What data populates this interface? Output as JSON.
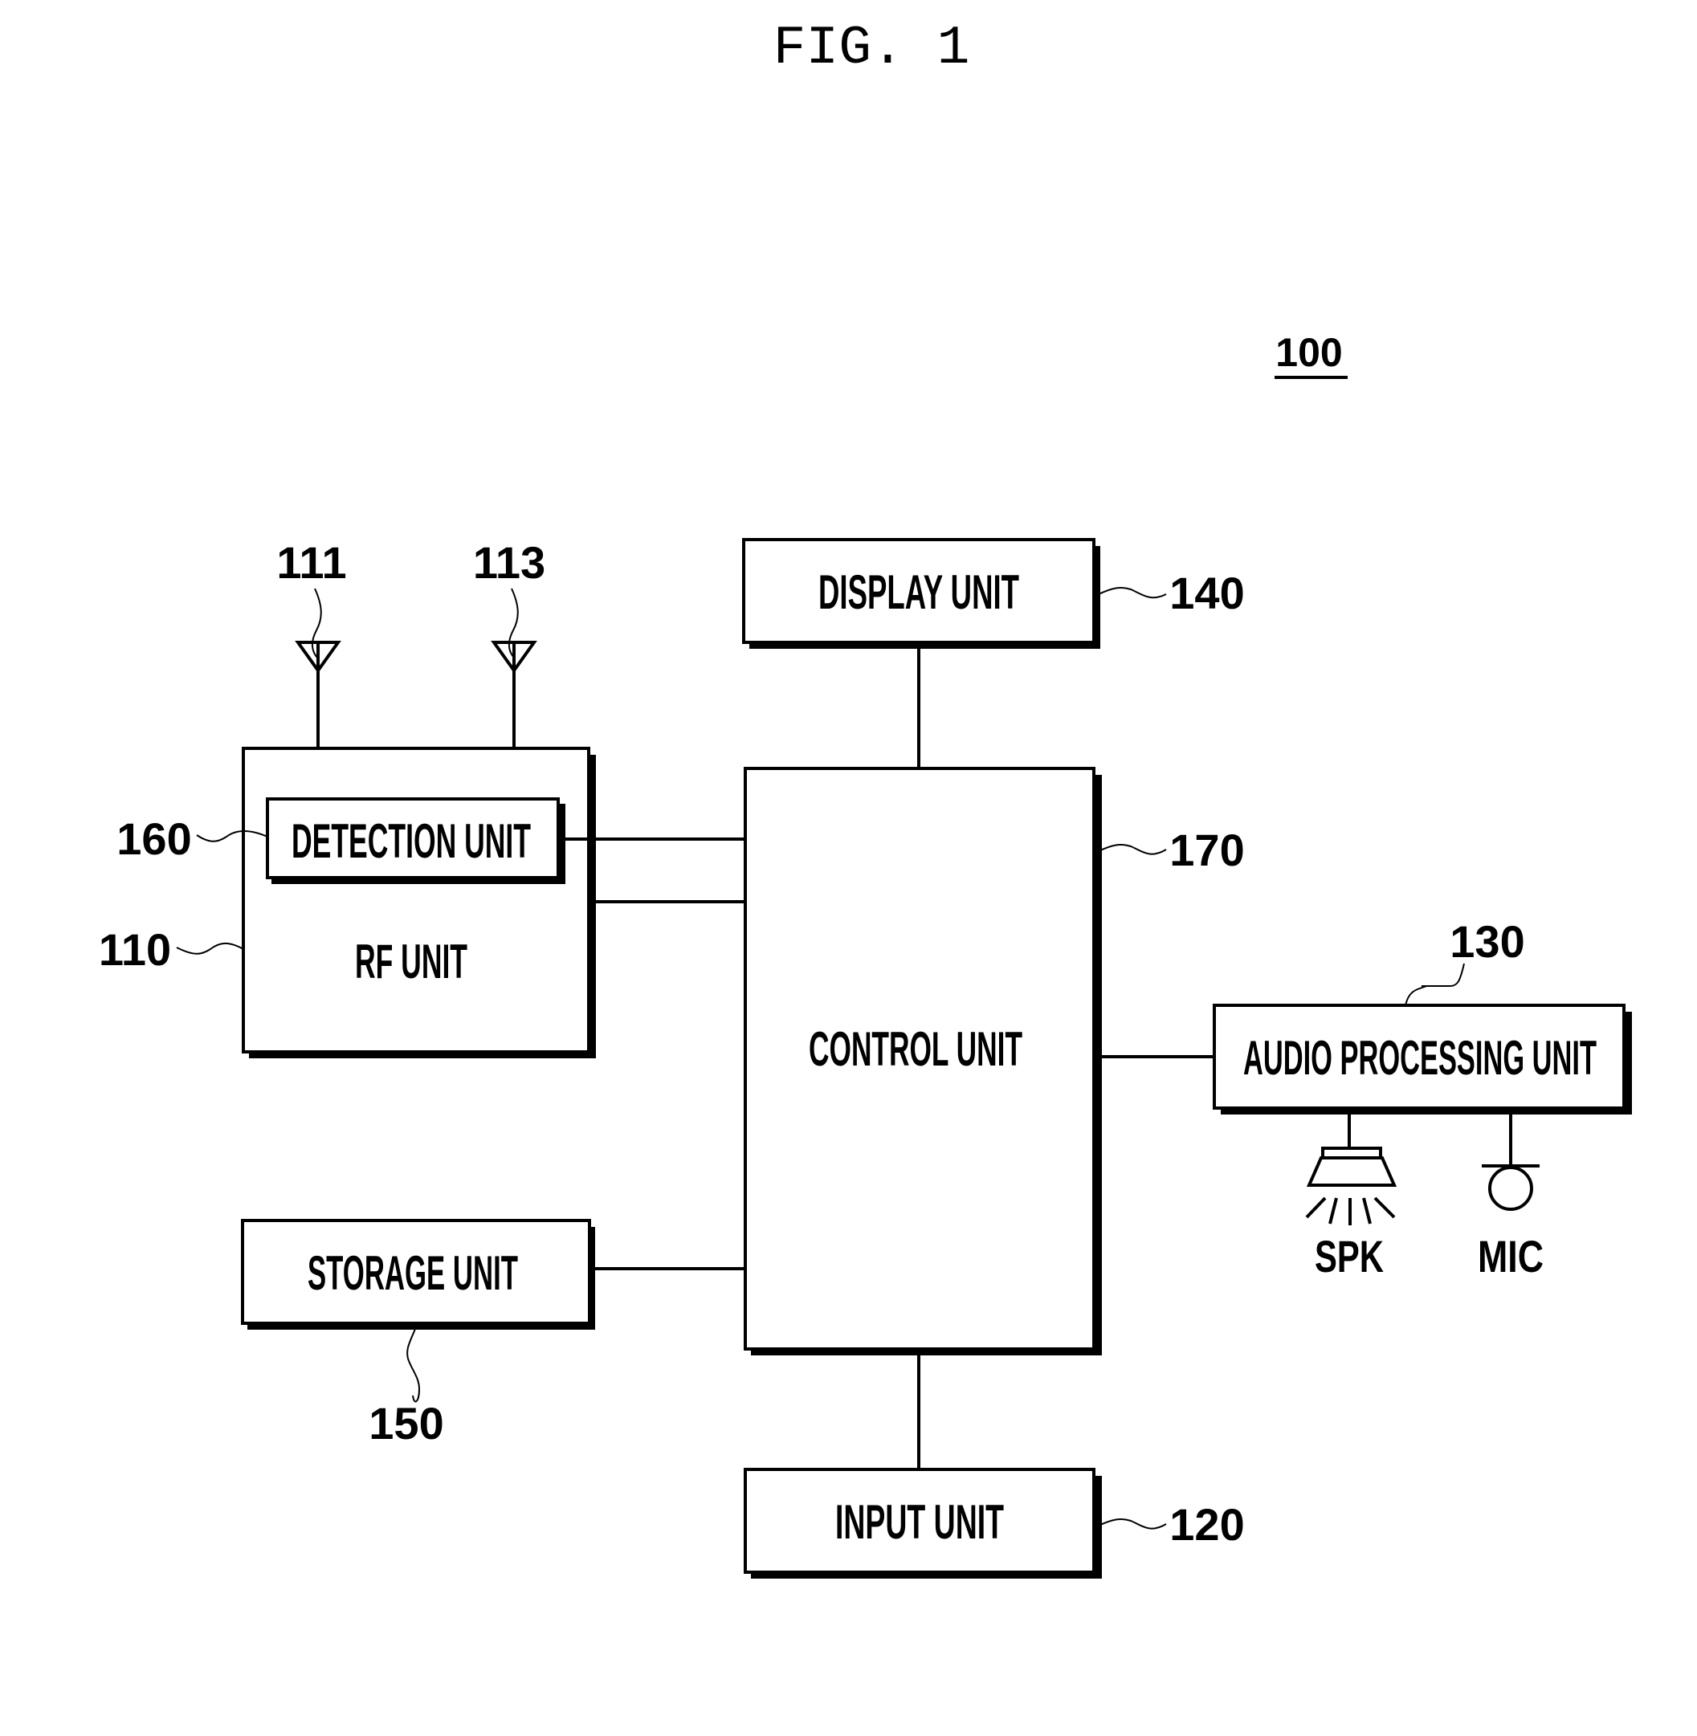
{
  "figure": {
    "title": "FIG. 1",
    "device_ref": "100"
  },
  "blocks": {
    "rf_unit": {
      "label": "RF UNIT",
      "ref": "110"
    },
    "detection_unit": {
      "label": "DETECTION UNIT",
      "ref": "160"
    },
    "display_unit": {
      "label": "DISPLAY UNIT",
      "ref": "140"
    },
    "control_unit": {
      "label": "CONTROL UNIT",
      "ref": "170"
    },
    "audio_processing_unit": {
      "label": "AUDIO PROCESSING UNIT",
      "ref": "130"
    },
    "storage_unit": {
      "label": "STORAGE UNIT",
      "ref": "150"
    },
    "input_unit": {
      "label": "INPUT UNIT",
      "ref": "120"
    }
  },
  "antennas": [
    {
      "ref": "111",
      "icon": "antenna-icon"
    },
    {
      "ref": "113",
      "icon": "antenna-icon"
    }
  ],
  "peripherals": {
    "speaker": {
      "label": "SPK",
      "icon": "speaker-icon"
    },
    "microphone": {
      "label": "MIC",
      "icon": "microphone-icon"
    }
  }
}
